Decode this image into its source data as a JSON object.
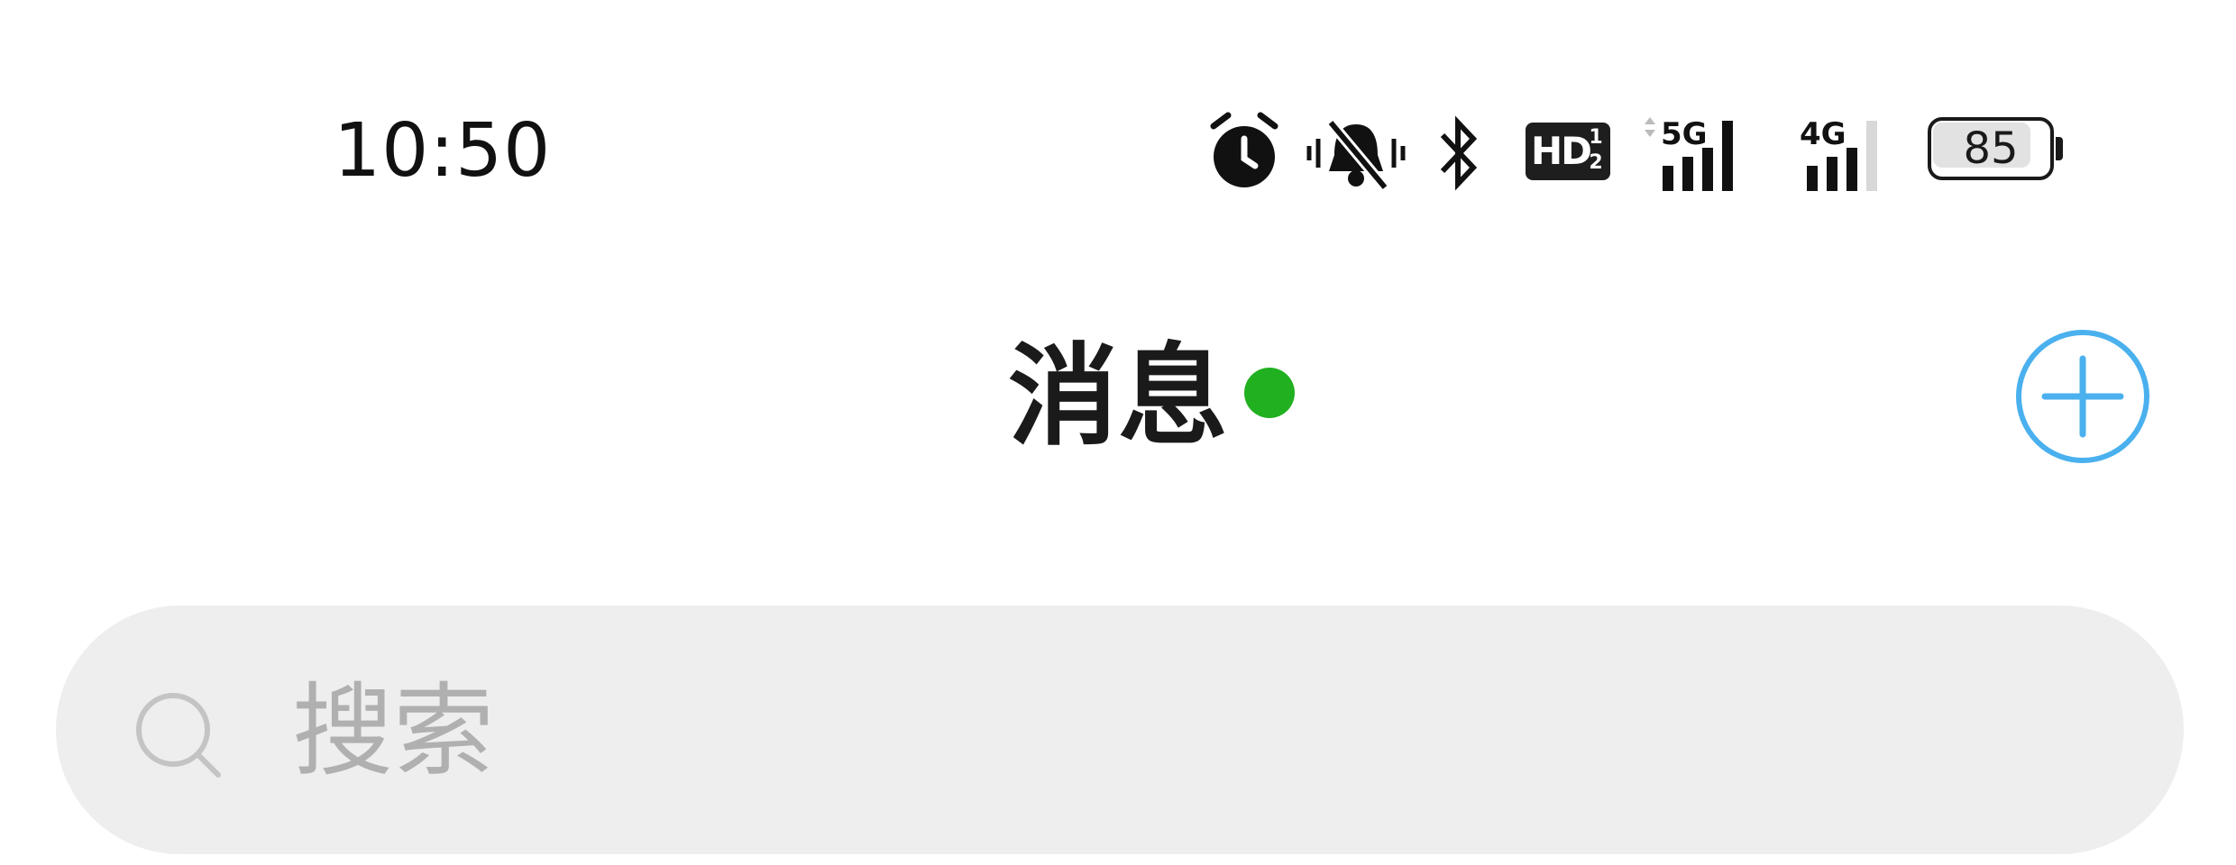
{
  "status_bar": {
    "time": "10:50",
    "network_badge": "HD",
    "network_badge_sup": "1",
    "network_badge_sub": "2",
    "signal_1_label": "5G",
    "signal_2_label": "4G",
    "battery_percent": "85",
    "icons": [
      "alarm-icon",
      "mute-vibrate-icon",
      "bluetooth-icon",
      "hd-voice-icon",
      "signal-5g-icon",
      "signal-4g-icon",
      "battery-icon"
    ]
  },
  "header": {
    "title": "消息",
    "online_status_color": "#21b020",
    "add_button_icon": "plus-circle-icon",
    "accent_color": "#4ab0ee"
  },
  "search": {
    "placeholder": "搜索",
    "icon": "search-icon"
  }
}
